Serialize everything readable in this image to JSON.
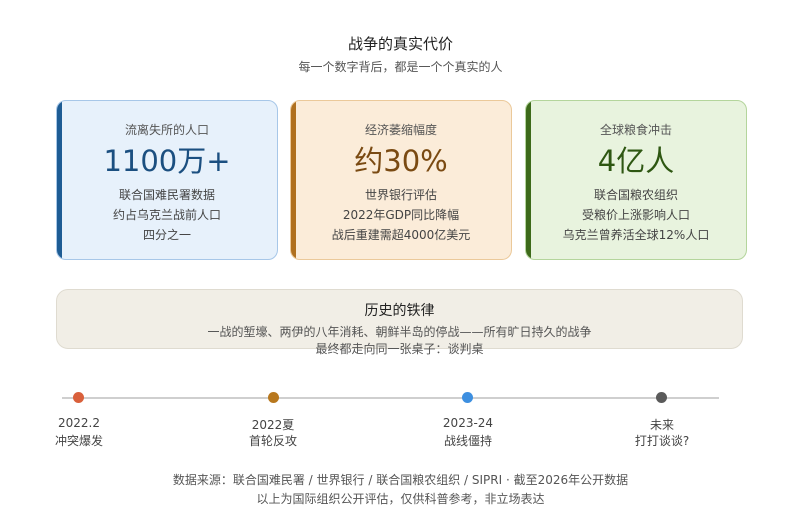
{
  "header": {
    "title": "战争的真实代价",
    "subtitle": "每一个数字背后，都是一个个真实的人"
  },
  "cards": [
    {
      "label": "流离失所的人口",
      "value": "1100万+",
      "lines": [
        "联合国难民署数据",
        "约占乌克兰战前人口",
        "四分之一"
      ],
      "accent": "#1e5c94"
    },
    {
      "label": "经济萎缩幅度",
      "value": "约30%",
      "lines": [
        "世界银行评估",
        "2022年GDP同比降幅",
        "战后重建需超4000亿美元"
      ],
      "accent": "#b0701e"
    },
    {
      "label": "全球粮食冲击",
      "value": "4亿人",
      "lines": [
        "联合国粮农组织",
        "受粮价上涨影响人口",
        "乌克兰曾养活全球12%人口"
      ],
      "accent": "#3d6a1a"
    }
  ],
  "history": {
    "title": "历史的铁律",
    "line1": "一战的堑壕、两伊的八年消耗、朝鲜半岛的停战——所有旷日持久的战争",
    "line2": "最终都走向同一张桌子：谈判桌"
  },
  "timeline": [
    {
      "date": "2022.2",
      "desc": "冲突爆发",
      "color": "#d9603b"
    },
    {
      "date": "2022夏",
      "desc": "首轮反攻",
      "color": "#b8781e"
    },
    {
      "date": "2023-24",
      "desc": "战线僵持",
      "color": "#3d8fe0"
    },
    {
      "date": "未来",
      "desc": "打打谈谈?",
      "color": "#5a5a5a"
    }
  ],
  "footer": {
    "source": "数据来源：联合国难民署 / 世界银行 / 联合国粮农组织 / SIPRI · 截至2026年公开数据",
    "disclaimer": "以上为国际组织公开评估，仅供科普参考，非立场表达"
  }
}
